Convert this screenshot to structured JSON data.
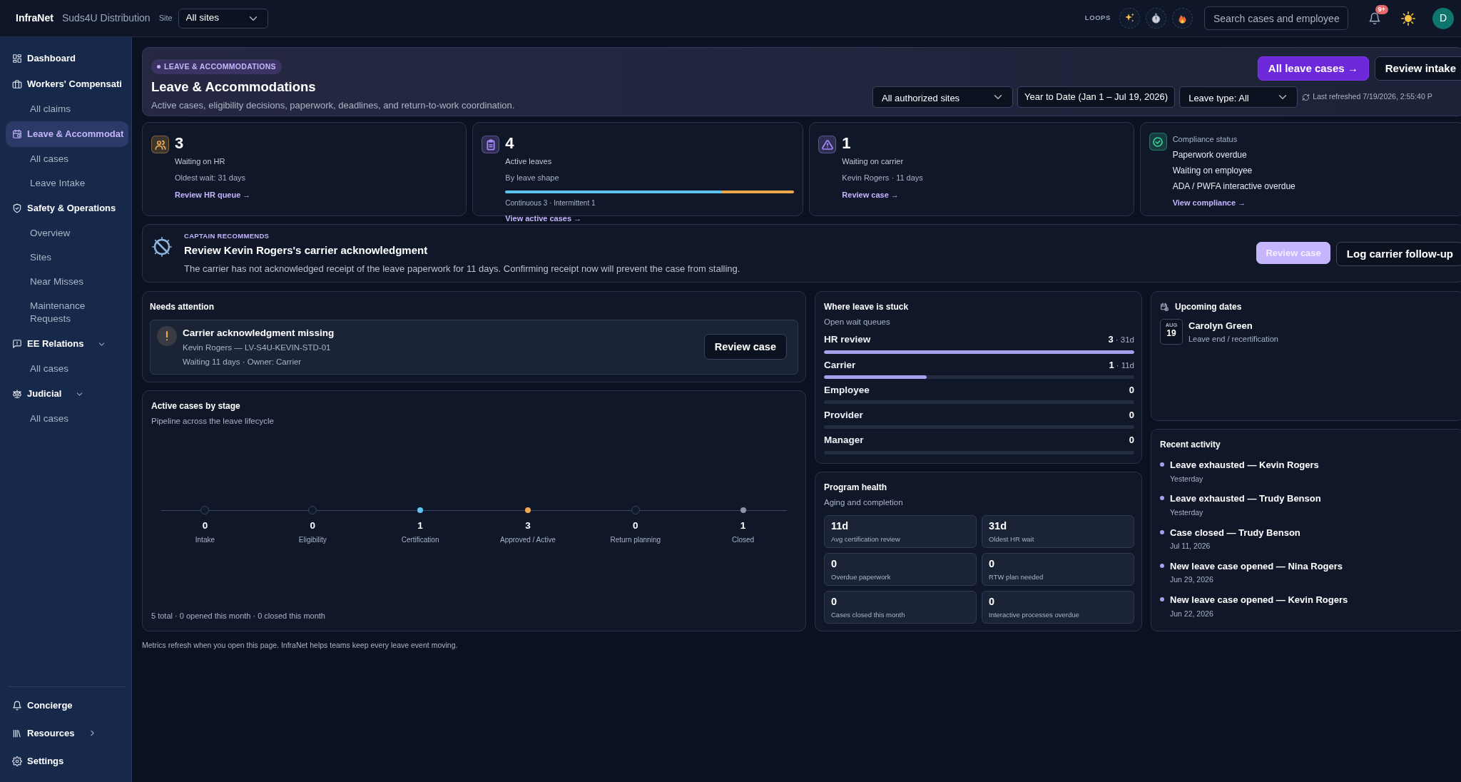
{
  "topbar": {
    "brand": "InfraNet",
    "org": "Suds4U Distribution",
    "site_label": "Site",
    "site_value": "All sites",
    "loops_label": "LOOPS",
    "search_placeholder": "Search cases and employee",
    "notification_badge": "9+",
    "avatar": "D"
  },
  "sidebar": {
    "items": [
      {
        "label": "Dashboard",
        "selected": false
      },
      {
        "label": "Workers' Compensati",
        "selected": false,
        "children": [
          {
            "label": "All claims",
            "selected": false
          }
        ]
      },
      {
        "label": "Leave & Accommodat",
        "selected": true,
        "children": [
          {
            "label": "All cases",
            "selected": false
          },
          {
            "label": "Leave Intake",
            "selected": false
          }
        ]
      },
      {
        "label": "Safety & Operations",
        "selected": false,
        "children": [
          {
            "label": "Overview",
            "selected": false
          },
          {
            "label": "Sites",
            "selected": false
          },
          {
            "label": "Near Misses",
            "selected": false
          },
          {
            "label": "Maintenance Requests",
            "selected": false
          }
        ]
      },
      {
        "label": "EE Relations",
        "selected": false,
        "expanded": true,
        "children": [
          {
            "label": "All cases",
            "selected": false
          }
        ]
      },
      {
        "label": "Judicial",
        "selected": false,
        "expanded": true,
        "children": [
          {
            "label": "All cases",
            "selected": false
          }
        ]
      }
    ],
    "footer": [
      {
        "label": "Concierge",
        "selected": false
      },
      {
        "label": "Resources",
        "selected": false,
        "expanded": false
      },
      {
        "label": "Settings",
        "selected": false
      }
    ]
  },
  "header": {
    "badge": "LEAVE & ACCOMMODATIONS",
    "title": "Leave & Accommodations",
    "subtitle": "Active cases, eligibility decisions, paperwork, deadlines, and return-to-work coordination.",
    "buttons": [
      {
        "label": "All leave cases →",
        "kind": "primary"
      },
      {
        "label": "Review intake",
        "kind": "outline"
      }
    ],
    "site_filter": "All authorized sites",
    "date_range": "Year to Date (Jan 1 – Jul 19, 2026)",
    "leave_type": "Leave type: All",
    "refreshed": "Last refreshed 7/19/2026, 2:55:40 P"
  },
  "kpis": [
    {
      "kind": "count",
      "value": "3",
      "label": "Waiting on HR",
      "detail": "Oldest wait: 31 days",
      "link": "Review HR queue →",
      "color": "#f0a84c"
    },
    {
      "kind": "shape",
      "value": "4",
      "label": "Active leaves",
      "detail": "By leave shape",
      "segments": [
        {
          "level": 0.75,
          "color": "#5ec4f0"
        },
        {
          "level": 0.25,
          "color": "#f0a84c"
        }
      ],
      "legend": "Continuous 3 · Intermittent 1",
      "link": "View active cases →",
      "color": "#a78bfa"
    },
    {
      "kind": "count",
      "value": "1",
      "label": "Waiting on carrier",
      "detail": "Kevin Rogers · 11 days",
      "link": "Review case →",
      "color": "#a78bfa"
    },
    {
      "kind": "compliance",
      "title": "Compliance status",
      "lines": [
        "Paperwork overdue",
        "Waiting on employee",
        "ADA / PWFA interactive overdue"
      ],
      "link": "View compliance →",
      "color": "#34d399"
    }
  ],
  "recommendation": {
    "eyebrow": "CAPTAIN RECOMMENDS",
    "title": "Review Kevin Rogers's carrier acknowledgment",
    "body": "The carrier has not acknowledged receipt of the leave paperwork for 11 days. Confirming receipt now will prevent the case from stalling.",
    "buttons": [
      {
        "label": "Review case",
        "kind": "primary"
      },
      {
        "label": "Log carrier follow-up",
        "kind": "outline"
      }
    ]
  },
  "needs_attention": {
    "title": "Needs attention",
    "items": [
      {
        "title": "Carrier acknowledgment missing",
        "meta": "Kevin Rogers — LV-S4U-KEVIN-STD-01",
        "detail": "Waiting 11 days · Owner: Carrier",
        "button": "Review case"
      }
    ]
  },
  "stages": {
    "title": "Active cases by stage",
    "subtitle": "Pipeline across the leave lifecycle",
    "items": [
      {
        "count": "0",
        "label": "Intake"
      },
      {
        "count": "0",
        "label": "Eligibility"
      },
      {
        "count": "1",
        "label": "Certification",
        "color": "#5ec4f0"
      },
      {
        "count": "3",
        "label": "Approved / Active",
        "color": "#f0a84c"
      },
      {
        "count": "0",
        "label": "Return planning"
      },
      {
        "count": "1",
        "label": "Closed",
        "color": "#8b93a7"
      }
    ],
    "footer": "5 total · 0 opened this month · 0 closed this month"
  },
  "stuck": {
    "title": "Where leave is stuck",
    "subtitle": "Open wait queues",
    "rows": [
      {
        "label": "HR review",
        "count": "3",
        "age": "· 31d",
        "level": 1.0
      },
      {
        "label": "Carrier",
        "count": "1",
        "age": "· 11d",
        "level": 0.33
      },
      {
        "label": "Employee",
        "count": "0",
        "level": 0
      },
      {
        "label": "Provider",
        "count": "0",
        "level": 0
      },
      {
        "label": "Manager",
        "count": "0",
        "level": 0
      }
    ]
  },
  "health": {
    "title": "Program health",
    "subtitle": "Aging and completion",
    "tiles": [
      {
        "value": "11d",
        "label": "Avg certification review"
      },
      {
        "value": "31d",
        "label": "Oldest HR wait"
      },
      {
        "value": "0",
        "label": "Overdue paperwork"
      },
      {
        "value": "0",
        "label": "RTW plan needed"
      },
      {
        "value": "0",
        "label": "Cases closed this month"
      },
      {
        "value": "0",
        "label": "Interactive processes overdue"
      }
    ]
  },
  "upcoming": {
    "title": "Upcoming dates",
    "items": [
      {
        "month": "AUG",
        "day": "19",
        "name": "Carolyn Green",
        "detail": "Leave end / recertification"
      }
    ]
  },
  "activity": {
    "title": "Recent activity",
    "items": [
      {
        "title": "Leave exhausted — Kevin Rogers",
        "time": "Yesterday"
      },
      {
        "title": "Leave exhausted — Trudy Benson",
        "time": "Yesterday"
      },
      {
        "title": "Case closed — Trudy Benson",
        "time": "Jul 11, 2026"
      },
      {
        "title": "New leave case opened — Nina Rogers",
        "time": "Jun 29, 2026"
      },
      {
        "title": "New leave case opened — Kevin Rogers",
        "time": "Jun 22, 2026"
      }
    ]
  },
  "footnote": "Metrics refresh when you open this page. InfraNet helps teams keep every leave event moving."
}
